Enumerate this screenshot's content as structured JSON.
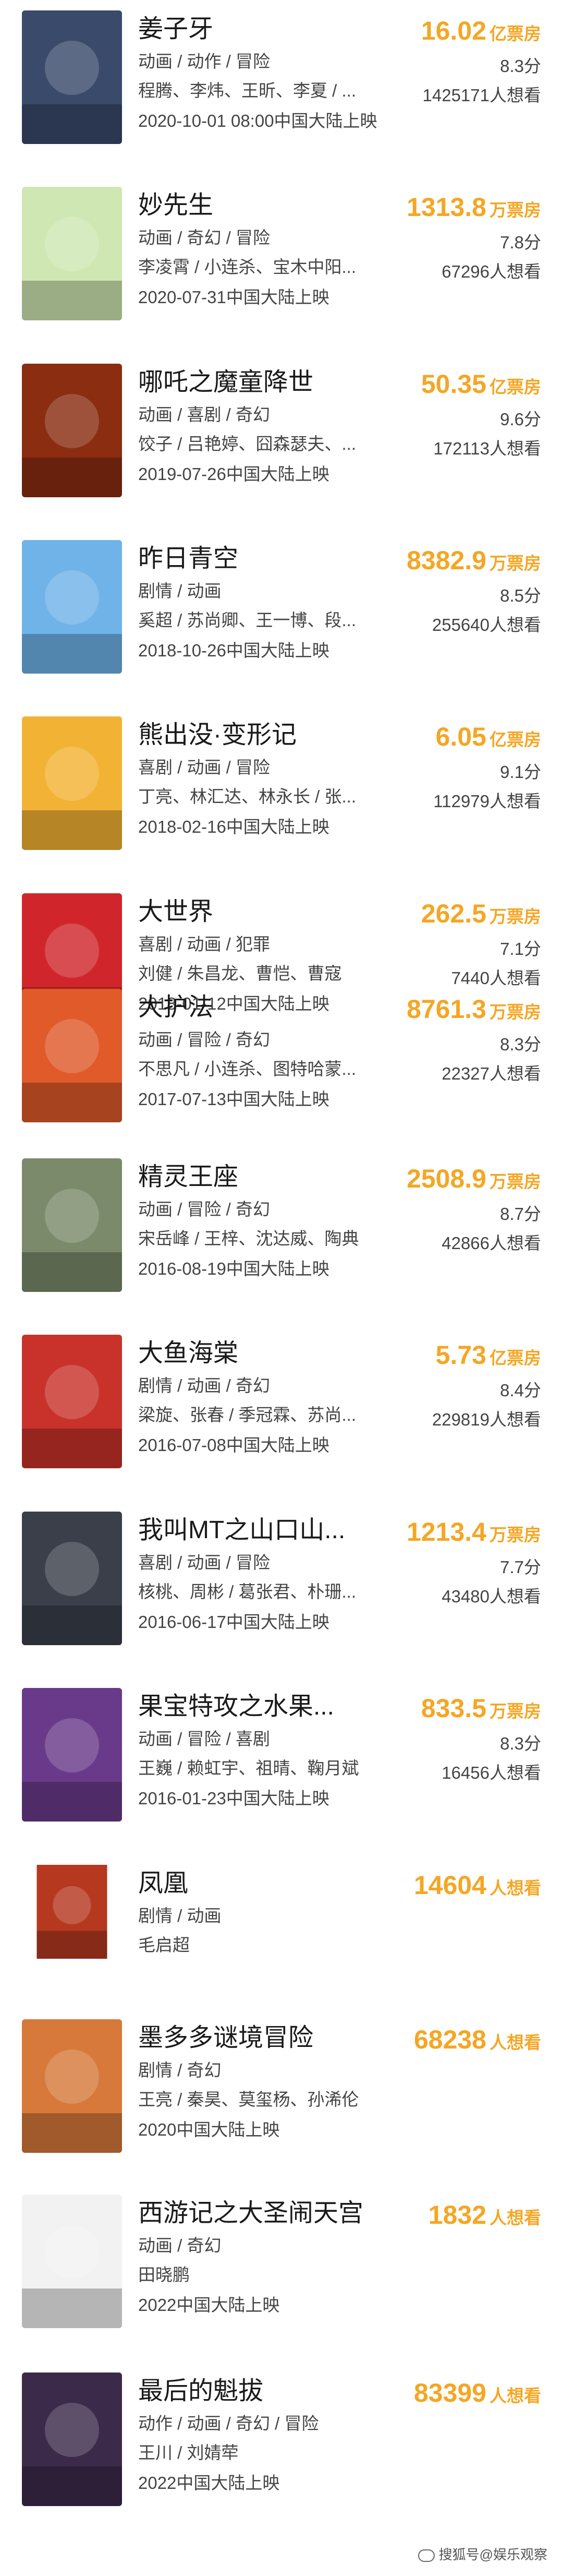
{
  "movies": [
    {
      "title": "姜子牙",
      "meta1": "动画 / 动作 / 冒险",
      "meta2": "程腾、李炜、王昕、李夏 / ...",
      "meta3": "2020-10-01 08:00中国大陆上映",
      "box_num": "16.02",
      "box_unit": "亿票房",
      "score": "8.3分",
      "want": "1425171人想看",
      "poster_color": "#3a4a6b"
    },
    {
      "title": "妙先生",
      "meta1": "动画 / 奇幻 / 冒险",
      "meta2": "李凌霄 / 小连杀、宝木中阳...",
      "meta3": "2020-07-31中国大陆上映",
      "box_num": "1313.8",
      "box_unit": "万票房",
      "score": "7.8分",
      "want": "67296人想看",
      "poster_color": "#cfe7b2"
    },
    {
      "title": "哪吒之魔童降世",
      "meta1": "动画 / 喜剧 / 奇幻",
      "meta2": "饺子 / 吕艳婷、囧森瑟夫、...",
      "meta3": "2019-07-26中国大陆上映",
      "box_num": "50.35",
      "box_unit": "亿票房",
      "score": "9.6分",
      "want": "172113人想看",
      "poster_color": "#8a2d10"
    },
    {
      "title": "昨日青空",
      "meta1": "剧情 / 动画",
      "meta2": "奚超 / 苏尚卿、王一博、段...",
      "meta3": "2018-10-26中国大陆上映",
      "box_num": "8382.9",
      "box_unit": "万票房",
      "score": "8.5分",
      "want": "255640人想看",
      "poster_color": "#6fb3e8"
    },
    {
      "title": "熊出没·变形记",
      "meta1": "喜剧 / 动画 / 冒险",
      "meta2": "丁亮、林汇达、林永长 / 张...",
      "meta3": "2018-02-16中国大陆上映",
      "box_num": "6.05",
      "box_unit": "亿票房",
      "score": "9.1分",
      "want": "112979人想看",
      "poster_color": "#f2b233"
    },
    {
      "title": "大世界",
      "meta1": "喜剧 / 动画 / 犯罪",
      "meta2": "刘健 / 朱昌龙、曹恺、曹寇",
      "meta3": "2018-01-12中国大陆上映",
      "box_num": "262.5",
      "box_unit": "万票房",
      "score": "7.1分",
      "want": "7440人想看",
      "poster_color": "#d0262b"
    },
    {
      "title": "大护法",
      "meta1": "动画 / 冒险 / 奇幻",
      "meta2": "不思凡 / 小连杀、图特哈蒙...",
      "meta3": "2017-07-13中国大陆上映",
      "box_num": "8761.3",
      "box_unit": "万票房",
      "score": "8.3分",
      "want": "22327人想看",
      "poster_color": "#e05a2a"
    },
    {
      "title": "精灵王座",
      "meta1": "动画 / 冒险 / 奇幻",
      "meta2": "宋岳峰 / 王梓、沈达威、陶典",
      "meta3": "2016-08-19中国大陆上映",
      "box_num": "2508.9",
      "box_unit": "万票房",
      "score": "8.7分",
      "want": "42866人想看",
      "poster_color": "#7a8a6a"
    },
    {
      "title": "大鱼海棠",
      "meta1": "剧情 / 动画 / 奇幻",
      "meta2": "梁旋、张春 / 季冠霖、苏尚...",
      "meta3": "2016-07-08中国大陆上映",
      "box_num": "5.73",
      "box_unit": "亿票房",
      "score": "8.4分",
      "want": "229819人想看",
      "poster_color": "#c8322a"
    },
    {
      "title": "我叫MT之山口山...",
      "meta1": "喜剧 / 动画 / 冒险",
      "meta2": "核桃、周彬 / 葛张君、朴珊...",
      "meta3": "2016-06-17中国大陆上映",
      "box_num": "1213.4",
      "box_unit": "万票房",
      "score": "7.7分",
      "want": "43480人想看",
      "poster_color": "#3a3f4a"
    },
    {
      "title": "果宝特攻之水果...",
      "meta1": "动画 / 冒险 / 喜剧",
      "meta2": "王巍 / 赖虹宇、祖晴、鞠月斌",
      "meta3": "2016-01-23中国大陆上映",
      "box_num": "833.5",
      "box_unit": "万票房",
      "score": "8.3分",
      "want": "16456人想看",
      "poster_color": "#6a3a8a"
    },
    {
      "title": "凤凰",
      "meta1": "剧情 / 动画",
      "meta2": "毛启超",
      "meta3": "",
      "box_num": "14604",
      "box_unit": "人想看",
      "score": "",
      "want": "",
      "poster_color": "#b5381f"
    },
    {
      "title": "墨多多谜境冒险",
      "meta1": "剧情 / 奇幻",
      "meta2": "王亮 / 秦昊、莫玺杨、孙浠伦",
      "meta3": "2020中国大陆上映",
      "box_num": "68238",
      "box_unit": "人想看",
      "score": "",
      "want": "",
      "poster_color": "#d6793a"
    },
    {
      "title": "西游记之大圣闹天宫",
      "meta1": "动画 / 奇幻",
      "meta2": "田晓鹏",
      "meta3": "2022中国大陆上映",
      "box_num": "1832",
      "box_unit": "人想看",
      "score": "",
      "want": "",
      "poster_color": "#f2f2f2"
    },
    {
      "title": "最后的魁拔",
      "meta1": "动作 / 动画 / 奇幻 / 冒险",
      "meta2": "王川 / 刘婧荦",
      "meta3": "2022中国大陆上映",
      "box_num": "83399",
      "box_unit": "人想看",
      "score": "",
      "want": "",
      "poster_color": "#3b2a4a"
    }
  ],
  "watermark": "搜狐号@娱乐观察",
  "icons": {
    "poster": "poster-image",
    "watermark": "wechat-icon"
  }
}
